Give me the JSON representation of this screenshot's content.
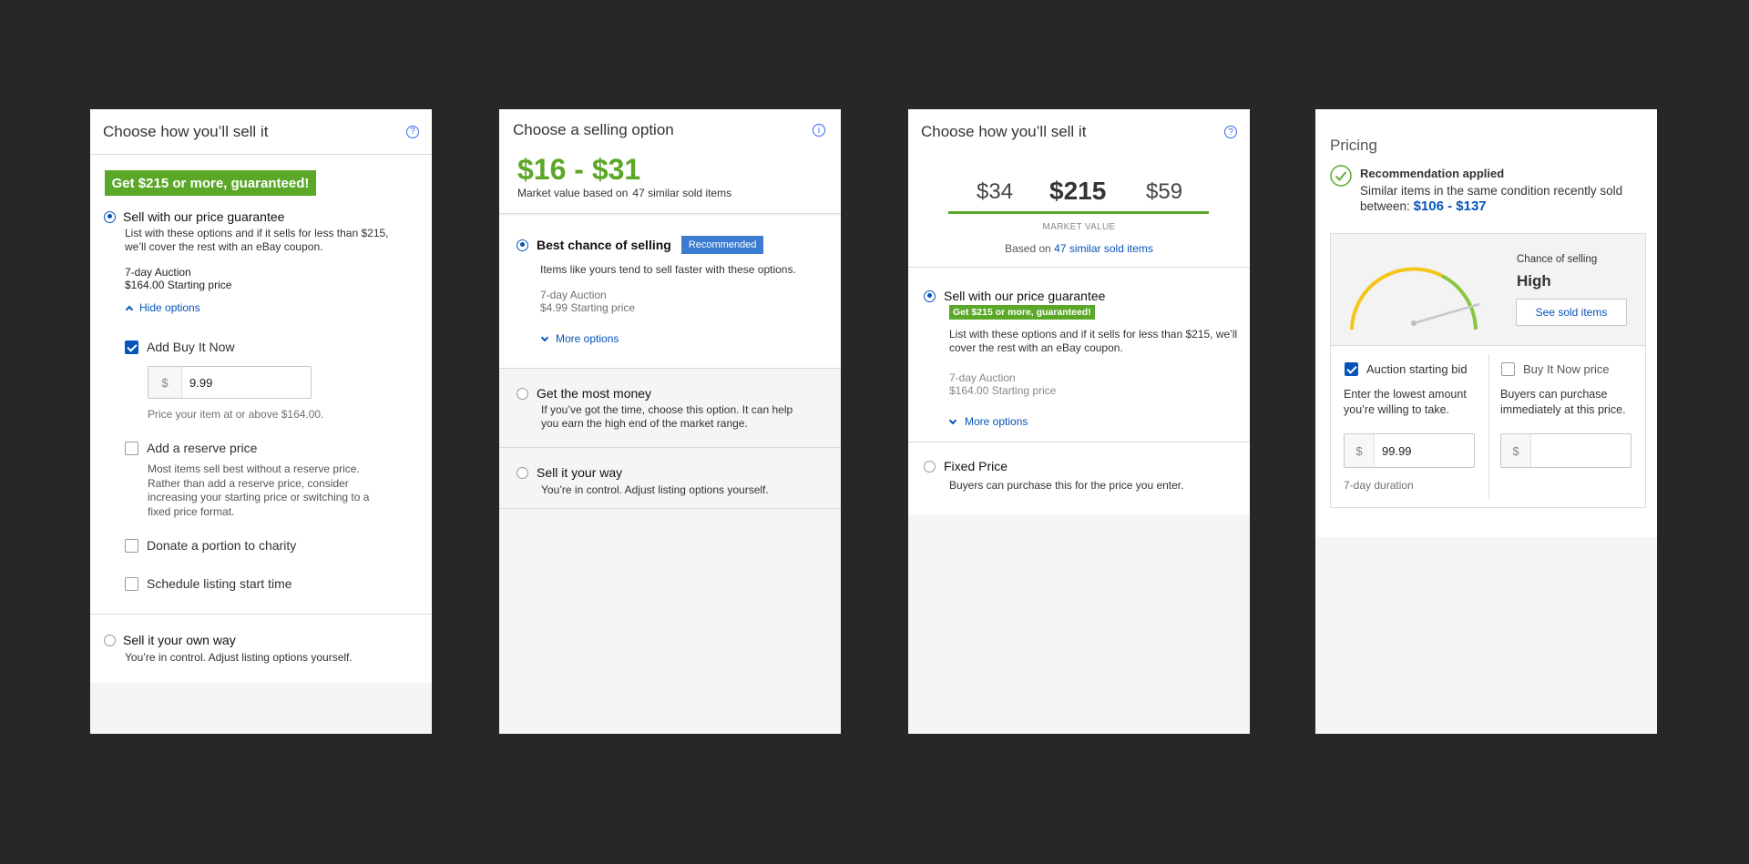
{
  "panel1": {
    "title": "Choose how you’ll sell it",
    "help_icon": "?",
    "banner": "Get $215 or more, guaranteed!",
    "option1_label": "Sell with our price guarantee",
    "option1_desc": "List with these options and if it sells for less than $215, we’ll cover the rest with an eBay coupon.",
    "auction_line1": "7-day Auction",
    "auction_line2": "$164.00 Starting price",
    "hide_options": "Hide options",
    "buy_now_label": "Add Buy It Now",
    "currency": "$",
    "buy_now_value": "9.99",
    "buy_now_hint": "Price your item at or above $164.00.",
    "reserve_label": "Add a reserve price",
    "reserve_desc": "Most items sell best without a reserve price. Rather than add a reserve price, consider increasing your starting price or switching to a fixed price format.",
    "charity_label": "Donate a portion to charity",
    "schedule_label": "Schedule listing start time",
    "option2_label": "Sell it your own way",
    "option2_desc": "You’re in control. Adjust listing options yourself."
  },
  "panel2": {
    "title": "Choose a selling option",
    "info_icon": "i",
    "price_range": "$16 - $31",
    "market_prefix": "Market value based on",
    "market_link": "47 similar sold items",
    "opt1_label": "Best chance of selling",
    "opt1_badge": "Recommended",
    "opt1_desc": "Items like yours tend to sell faster with these options.",
    "opt1_line1": "7-day Auction",
    "opt1_line2": "$4.99 Starting price",
    "more_options": "More options",
    "opt2_label": "Get the most money",
    "opt2_desc": "If you’ve got the time, choose this option. It can help you earn the high end of the market range.",
    "opt3_label": "Sell it your way",
    "opt3_desc": "You’re in control. Adjust listing options yourself."
  },
  "panel3": {
    "title": "Choose how you’ll sell it",
    "help_icon": "?",
    "price_low": "$34",
    "price_mid": "$215",
    "price_high": "$59",
    "market_value": "MARKET VALUE",
    "based_on": "Based on",
    "based_link": "47 similar sold items",
    "opt1_label": "Sell with our price guarantee",
    "opt1_badge": "Get $215 or more, guaranteed!",
    "opt1_desc": "List with these options and if it sells for less than $215, we’ll cover the rest with an eBay coupon.",
    "opt1_line1": "7-day Auction",
    "opt1_line2": "$164.00 Starting price",
    "more_options": "More options",
    "opt2_label": "Fixed Price",
    "opt2_desc": "Buyers can purchase this for the price you enter."
  },
  "panel4": {
    "title": "Pricing",
    "applied_title": "Recommendation applied",
    "applied_desc": "Similar items in the same condition recently sold between:",
    "applied_range": "$106 - $137",
    "chance_label": "Chance of selling",
    "chance_value": "High",
    "see_sold": "See sold items",
    "auction_label": "Auction starting bid",
    "auction_desc": "Enter the lowest amount you’re willing to take.",
    "currency": "$",
    "auction_value": "99.99",
    "duration": "7-day duration",
    "bin_label": "Buy It Now price",
    "bin_desc": "Buyers can purchase immediately at this price."
  }
}
